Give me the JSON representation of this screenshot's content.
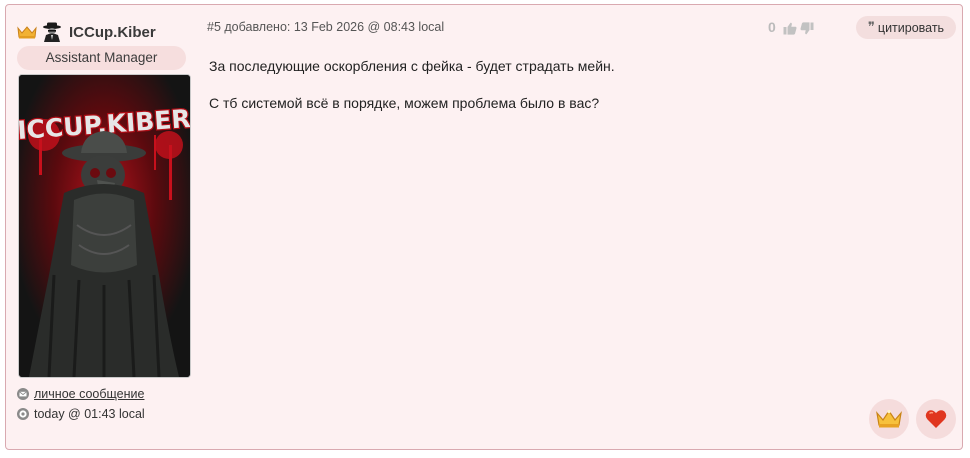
{
  "author": {
    "name": "ICCup.Kiber",
    "role": "Assistant Manager",
    "avatar_text": "ICCUP.KIBER",
    "pm_label": "личное сообщение",
    "last_seen": "today @ 01:43 local"
  },
  "post": {
    "meta": "#5 добавлено: 13 Feb 2026 @ 08:43 local",
    "rating": "0",
    "quote_label": "цитировать",
    "paragraphs": [
      "За последующие оскорбления с фейка - будет страдать мейн.",
      "С тб системой всё в порядке, можем проблема было в вас?"
    ]
  },
  "icons": {
    "crown": "crown-icon",
    "agent": "spy-agent-icon",
    "envelope": "envelope-icon",
    "clock": "clock-icon",
    "thumb_up": "thumbs-up-icon",
    "thumb_down": "thumbs-down-icon",
    "quote": "quote-icon",
    "heart": "heart-icon"
  },
  "colors": {
    "post_background": "#fdf1f2",
    "post_border": "#d9a9b0",
    "badge_background": "#f6dede",
    "avatar_red": "#c8101c"
  }
}
